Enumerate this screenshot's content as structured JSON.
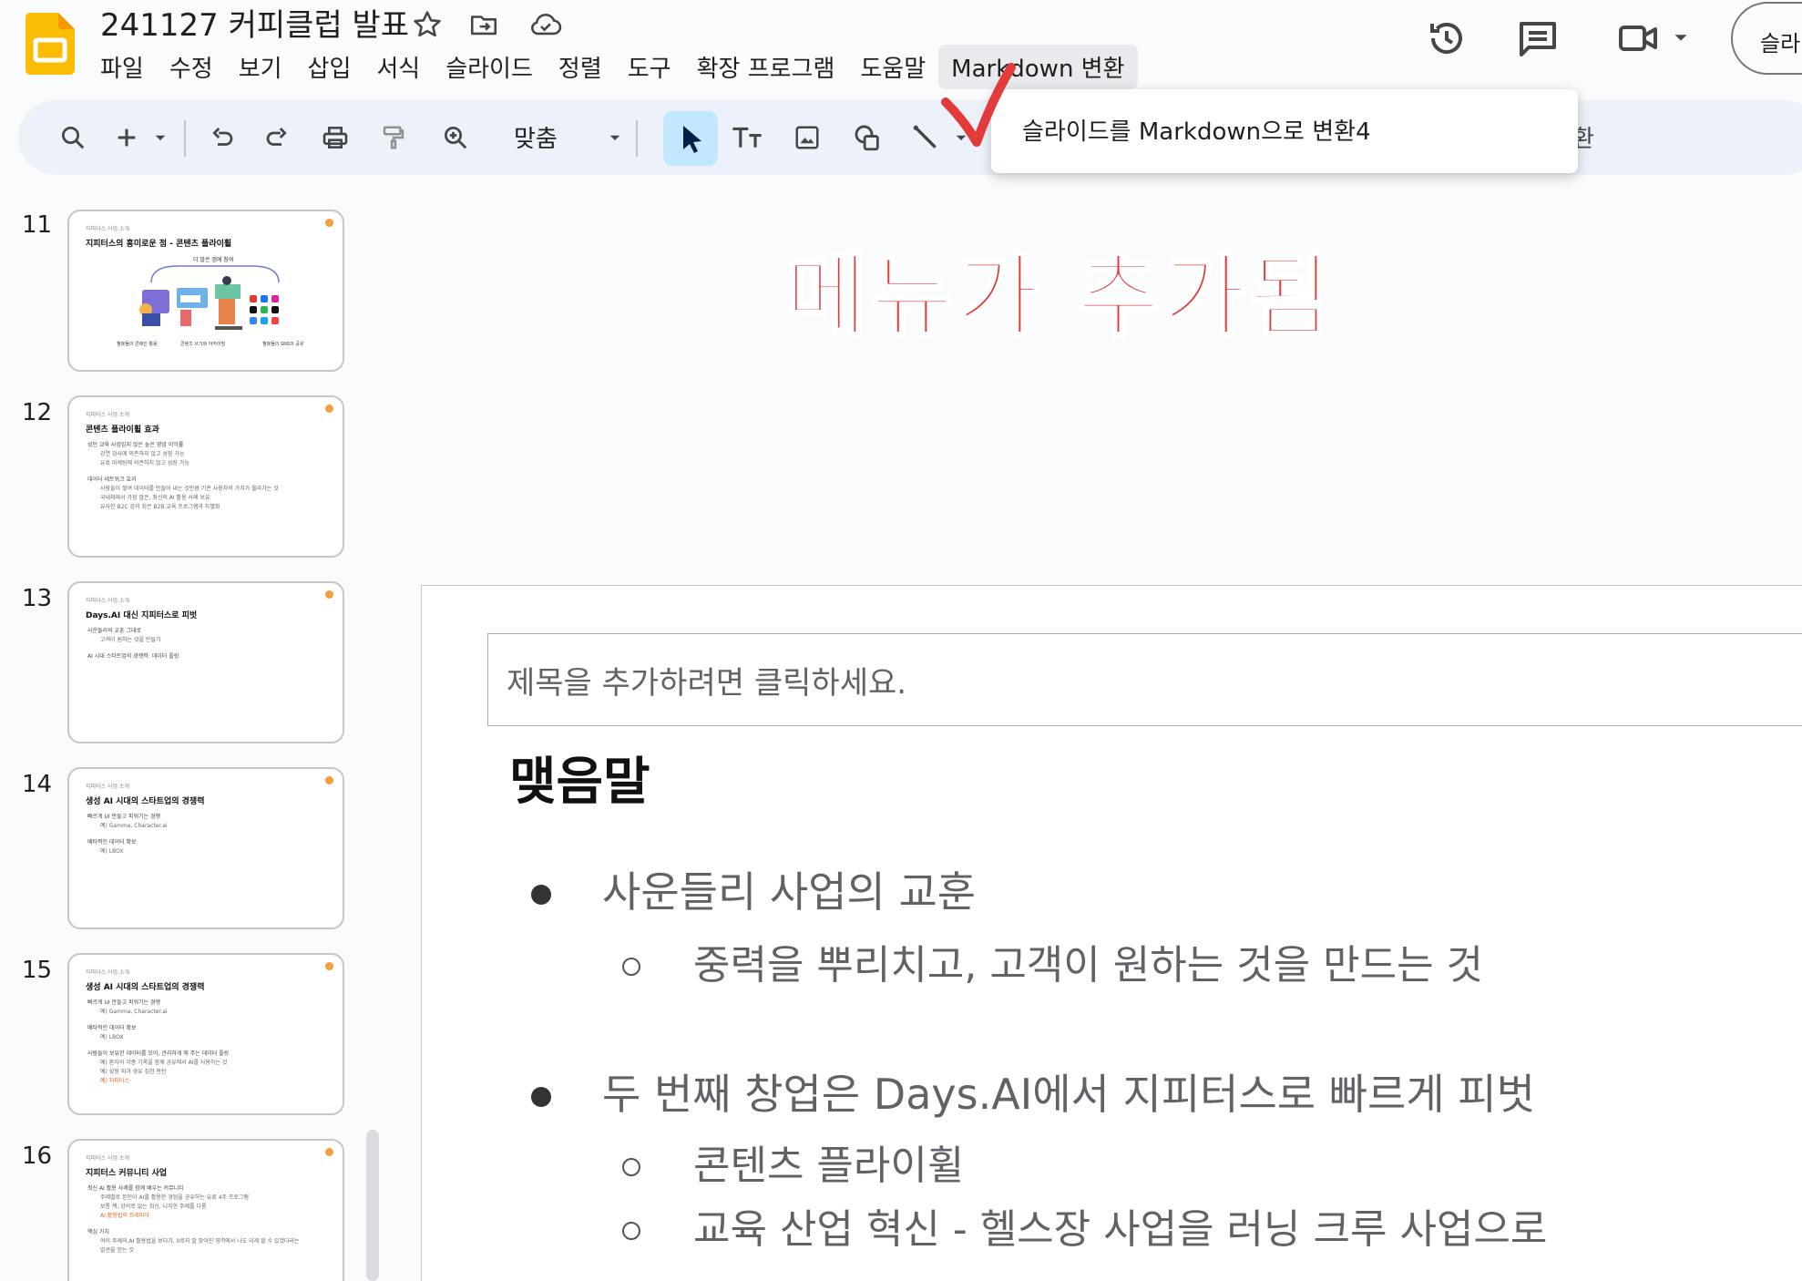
{
  "doc": {
    "title": "241127 커피클럽 발표",
    "icons": [
      "slides-logo-icon",
      "star-icon",
      "move-folder-icon",
      "cloud-saved-icon"
    ]
  },
  "menu": [
    {
      "label": "파일"
    },
    {
      "label": "수정"
    },
    {
      "label": "보기"
    },
    {
      "label": "삽입"
    },
    {
      "label": "서식"
    },
    {
      "label": "슬라이드"
    },
    {
      "label": "정렬"
    },
    {
      "label": "도구"
    },
    {
      "label": "확장 프로그램"
    },
    {
      "label": "도움말"
    },
    {
      "label": "Markdown 변환"
    }
  ],
  "header_right": {
    "share_label": "슬라",
    "icons": [
      "history-icon",
      "comment-icon",
      "video-call-icon",
      "chevron-down-icon"
    ]
  },
  "toolbar": {
    "zoom_label": "맞춤",
    "partial_right_text": "환",
    "icons": [
      "search-icon",
      "add-icon",
      "undo-icon",
      "redo-icon",
      "print-icon",
      "paint-format-icon",
      "zoom-icon",
      "select-icon",
      "text-box-icon",
      "image-icon",
      "shape-icon",
      "line-icon"
    ]
  },
  "dropdown": {
    "item": "슬라이드를 Markdown으로 변환4"
  },
  "annotation": {
    "note": "메뉴가 추가됨",
    "accent": "#e33b3b"
  },
  "slides": [
    {
      "num": "11",
      "kicker": "지피터스 사업 소개",
      "title": "지피터스의 흥미로운 점 - 콘텐츠 플라이휠",
      "diagram_top": "더 많은 앱에 참여",
      "captions": [
        "챌봇들의 콘테인 활용",
        "콘텐츠 쓰기와 아카이빙",
        "챌봇들의 SNS의 공유"
      ]
    },
    {
      "num": "12",
      "kicker": "지피터스 사업 소개",
      "title": "콘텐츠 플라이휠 효과",
      "bullets": [
        {
          "t": "성인 교육 사업임지 않은 높은 영업 이익률",
          "lvl": 1
        },
        {
          "t": "강연 강사에 의존하지 않고 성장 가능",
          "lvl": 2
        },
        {
          "t": "유료 마케팅에 의존하지 않고 성장 가능",
          "lvl": 2
        },
        {
          "t": "",
          "lvl": 0
        },
        {
          "t": "데이터 네트워크 효과",
          "lvl": 1
        },
        {
          "t": "사람들이 쌓여 데이터를 만들어 내는 것만큼 기존 사용자의 가치가 올라가는 것",
          "lvl": 2
        },
        {
          "t": "국내외에서 가장 많은, 최신의 AI 활용 사례 보유",
          "lvl": 2
        },
        {
          "t": "유사한 B2C 강의 회은 B2B 교육 프로그램과 차별화",
          "lvl": 2
        }
      ]
    },
    {
      "num": "13",
      "kicker": "지피터스 사업 소개",
      "title": "Days.AI 대신 지피터스로 피벗",
      "bullets": [
        {
          "t": "사운들리의 교훈 그대로",
          "lvl": 1
        },
        {
          "t": "고객이 원하는 것을 만들기",
          "lvl": 2
        },
        {
          "t": "",
          "lvl": 0
        },
        {
          "t": "AI 시대 스타트업의 경쟁력: 데이터 플링",
          "lvl": 1
        }
      ]
    },
    {
      "num": "14",
      "kicker": "지피터스 사업 소개",
      "title": "생성 AI 시대의 스타트업의 경쟁력",
      "bullets": [
        {
          "t": "빠르게 UI 만들고 피워기는 경쟁",
          "lvl": 1
        },
        {
          "t": "예) Gamma, Character.ai",
          "lvl": 2
        },
        {
          "t": "",
          "lvl": 0
        },
        {
          "t": "배타적인 데이터 확보",
          "lvl": 1
        },
        {
          "t": "예) LBOX",
          "lvl": 2
        }
      ]
    },
    {
      "num": "15",
      "kicker": "지피터스 사업 소개",
      "title": "생성 AI 시대의 스타트업의 경쟁력",
      "bullets": [
        {
          "t": "빠르게 UI 만들고 피워기는 경쟁",
          "lvl": 1
        },
        {
          "t": "예) Gamma, Character.ai",
          "lvl": 2
        },
        {
          "t": "",
          "lvl": 0
        },
        {
          "t": "배타적인 데이터 확보",
          "lvl": 1
        },
        {
          "t": "예) LBOX",
          "lvl": 2
        },
        {
          "t": "",
          "lvl": 0
        },
        {
          "t": "사람들이 보유한 데이터를 모아, 관리하게 해 주는 데이터 플링",
          "lvl": 1
        },
        {
          "t": "예) 환자의 각종 기록을 함께 공유해서 AI를 사용하는 것",
          "lvl": 2
        },
        {
          "t": "예) 성형 외과 경유 집한 판탄",
          "lvl": 2
        },
        {
          "t": "예) 지피터스",
          "lvl": 3
        }
      ]
    },
    {
      "num": "16",
      "kicker": "지피터스 사업 소개",
      "title": "지피터스 커뮤니티 사업",
      "bullets": [
        {
          "t": "최신 AI 활용 사례를 함께 배우는 커뮤니티",
          "lvl": 1
        },
        {
          "t": "주제별로 본인이 AI를 활용한 경험을 공유하는 유료 4주 프로그램",
          "lvl": 2
        },
        {
          "t": "보통 책, 강의로 없는 최신, 니치한 주제를 다룸",
          "lvl": 2
        },
        {
          "t": "AI 활용법의 프레미아",
          "lvl": 3
        },
        {
          "t": "",
          "lvl": 0
        },
        {
          "t": "핵심 가치",
          "lvl": 1
        },
        {
          "t": "여러 주제의 AI 활용법을 보다가, 0로지 잘 맞아진 영역에서 나도 이제 할 수 있겠다라는",
          "lvl": 2
        },
        {
          "t": "발견을 얻는 것",
          "lvl": 2
        }
      ]
    }
  ],
  "canvas": {
    "title_placeholder": "제목을 추가하려면 클릭하세요.",
    "heading": "맺음말",
    "bullets": [
      {
        "text": "사운들리 사업의 교훈",
        "level": 1
      },
      {
        "text": "중력을 뿌리치고, 고객이 원하는 것을 만드는 것",
        "level": 2
      },
      {
        "text": "두 번째 창업은 Days.AI에서 지피터스로 빠르게 피벗",
        "level": 1
      },
      {
        "text": "콘텐츠 플라이휠",
        "level": 2
      },
      {
        "text": "교육 산업 혁신 - 헬스장 사업을 러닝 크루 사업으로",
        "level": 2
      }
    ]
  }
}
